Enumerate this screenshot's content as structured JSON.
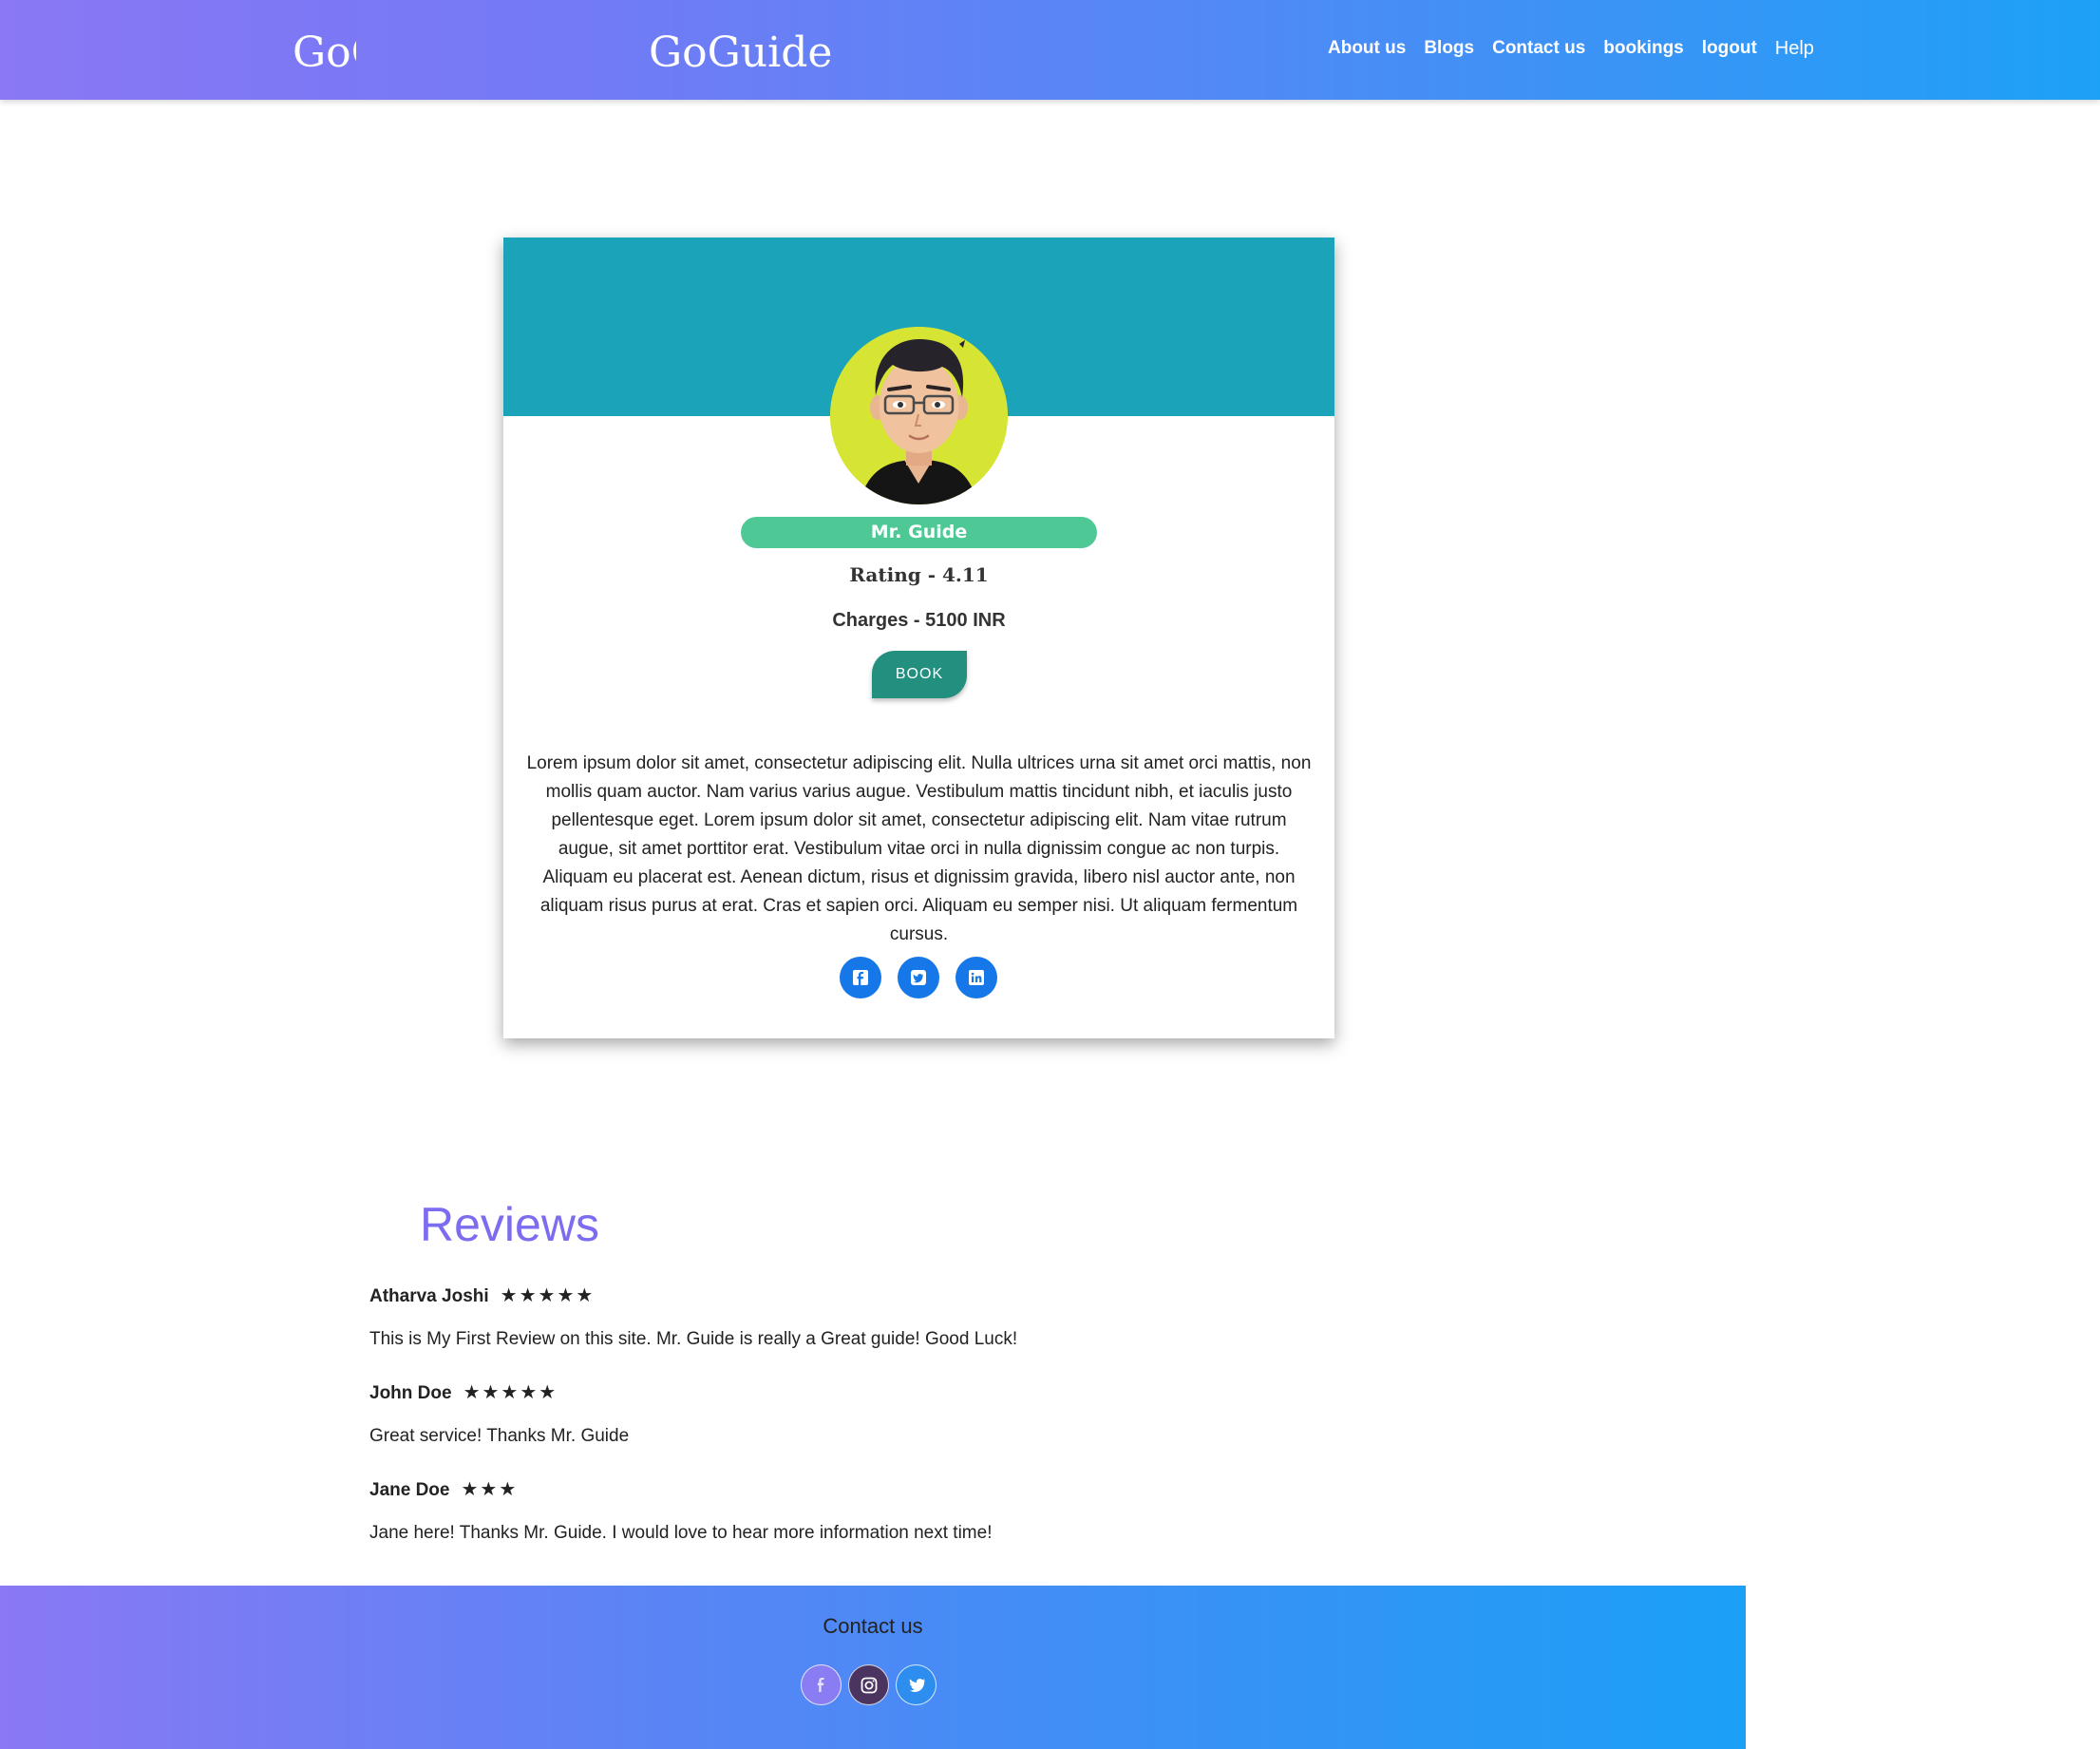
{
  "header": {
    "brand": "GoGuide",
    "ghost_brand": "GoG",
    "nav": [
      "About us",
      "Blogs",
      "Contact us",
      "bookings",
      "logout",
      "Help"
    ]
  },
  "profile": {
    "name": "Mr.  Guide",
    "rating": "Rating - 4.11",
    "charges": "Charges - 5100 INR",
    "book_label": "BOOK",
    "bio": "Lorem ipsum dolor sit amet, consectetur adipiscing elit. Nulla ultrices urna sit amet orci mattis, non mollis quam auctor. Nam varius varius augue. Vestibulum mattis tincidunt nibh, et iaculis justo pellentesque eget. Lorem ipsum dolor sit amet, consectetur adipiscing elit. Nam vitae rutrum augue, sit amet porttitor erat. Vestibulum vitae orci in nulla dignissim congue ac non turpis. Aliquam eu placerat est. Aenean dictum, risus et dignissim gravida, libero nisl auctor ante, non aliquam risus purus at erat. Cras et sapien orci. Aliquam eu semper nisi. Ut aliquam fermentum cursus.",
    "socials": [
      "facebook-icon",
      "twitter-icon",
      "linkedin-icon"
    ],
    "colors": {
      "banner": "#1ba3ba",
      "name_pill": "#4ec995",
      "book": "#23907f",
      "social": "#1677e8"
    }
  },
  "reviews": {
    "title": "Reviews",
    "items": [
      {
        "author": "Atharva Joshi",
        "stars": "★★★★★",
        "rating": 5,
        "text": "This is My First Review on this site. Mr. Guide is really a Great guide! Good Luck!"
      },
      {
        "author": "John Doe",
        "stars": "★★★★★",
        "rating": 5,
        "text": "Great service! Thanks Mr. Guide"
      },
      {
        "author": "Jane Doe",
        "stars": "★★★",
        "rating": 3,
        "text": "Jane here! Thanks Mr. Guide. I would love to hear more information next time!"
      }
    ]
  },
  "footer": {
    "title": "Contact us",
    "socials": [
      "facebook-icon",
      "instagram-icon",
      "twitter-icon"
    ]
  }
}
